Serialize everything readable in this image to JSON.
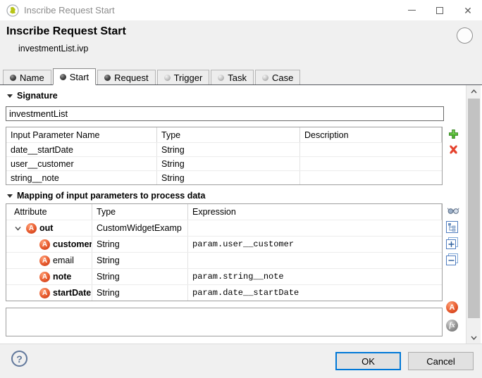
{
  "window": {
    "title": "Inscribe Request Start"
  },
  "header": {
    "title": "Inscribe Request Start",
    "subtitle": "investmentList.ivp"
  },
  "tabs": [
    {
      "label": "Name"
    },
    {
      "label": "Start"
    },
    {
      "label": "Request"
    },
    {
      "label": "Trigger"
    },
    {
      "label": "Task"
    },
    {
      "label": "Case"
    }
  ],
  "signature": {
    "section_label": "Signature",
    "name_value": "investmentList",
    "params_table": {
      "columns": [
        "Input Parameter Name",
        "Type",
        "Description"
      ],
      "rows": [
        {
          "name": "date__startDate",
          "type": "String",
          "description": ""
        },
        {
          "name": "user__customer",
          "type": "String",
          "description": ""
        },
        {
          "name": "string__note",
          "type": "String",
          "description": ""
        }
      ]
    }
  },
  "mapping": {
    "section_label": "Mapping of input parameters to process data",
    "columns": [
      "Attribute",
      "Type",
      "Expression"
    ],
    "rows": [
      {
        "attribute": "out",
        "type": "CustomWidgetExamp",
        "expression": ""
      },
      {
        "attribute": "customer",
        "type": "String",
        "expression": "param.user__customer"
      },
      {
        "attribute": "email",
        "type": "String",
        "expression": ""
      },
      {
        "attribute": "note",
        "type": "String",
        "expression": "param.string__note"
      },
      {
        "attribute": "startDate",
        "type": "String",
        "expression": "param.date__startDate"
      }
    ],
    "attribute_badge_letter": "A"
  },
  "expression_editor": {
    "value": "",
    "fx_label": "fx",
    "a_label": "A"
  },
  "footer": {
    "help": "?",
    "ok": "OK",
    "cancel": "Cancel"
  },
  "colors": {
    "accent_blue": "#0078d7",
    "add_green": "#3da52e",
    "delete_red": "#e5432e",
    "attribute_orange": "#e65b2e",
    "chrome_gray": "#f0f0f0"
  }
}
